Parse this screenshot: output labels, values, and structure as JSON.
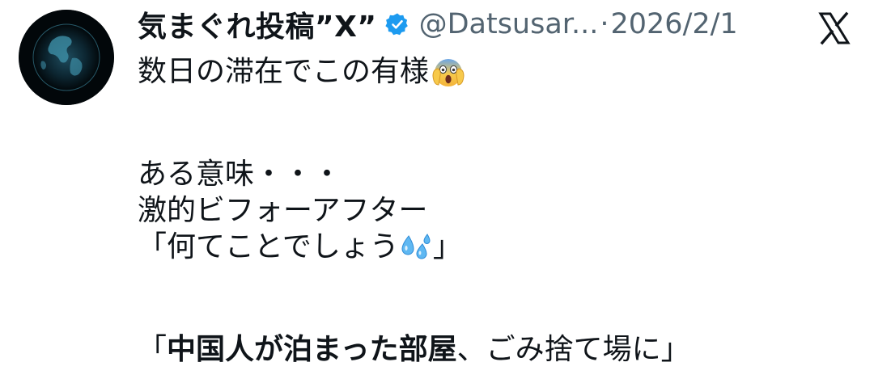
{
  "tweet": {
    "display_name": "気まぐれ投稿”X”",
    "handle": "@Datsusar...",
    "separator": "·",
    "date": "2026/2/1",
    "lines": {
      "l1": "数日の滞在でこの有様",
      "l2": "ある意味・・・",
      "l3": "激的ビフォーアフター",
      "l4_a": "「何てことでしょう",
      "l4_b": "」",
      "l5_open": "「",
      "l5_bold": "中国人が泊まった部屋",
      "l5_rest": "、ごみ捨て場に」"
    }
  },
  "icons": {
    "avatar": "earth-globe-avatar",
    "verified": "verified-badge-icon",
    "platform": "x-logo-icon",
    "emoji_1": "screaming-face-emoji",
    "emoji_2": "sweat-droplets-emoji"
  },
  "colors": {
    "text": "#0f1419",
    "secondary": "#536471",
    "verified_blue": "#1d9bf0",
    "background": "#ffffff"
  }
}
